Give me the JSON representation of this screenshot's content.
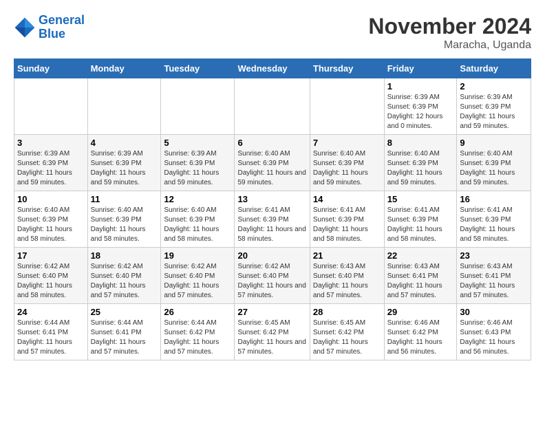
{
  "header": {
    "logo_general": "General",
    "logo_blue": "Blue",
    "month_title": "November 2024",
    "location": "Maracha, Uganda"
  },
  "days_of_week": [
    "Sunday",
    "Monday",
    "Tuesday",
    "Wednesday",
    "Thursday",
    "Friday",
    "Saturday"
  ],
  "weeks": [
    [
      {
        "day": "",
        "detail": ""
      },
      {
        "day": "",
        "detail": ""
      },
      {
        "day": "",
        "detail": ""
      },
      {
        "day": "",
        "detail": ""
      },
      {
        "day": "",
        "detail": ""
      },
      {
        "day": "1",
        "detail": "Sunrise: 6:39 AM\nSunset: 6:39 PM\nDaylight: 12 hours and 0 minutes."
      },
      {
        "day": "2",
        "detail": "Sunrise: 6:39 AM\nSunset: 6:39 PM\nDaylight: 11 hours and 59 minutes."
      }
    ],
    [
      {
        "day": "3",
        "detail": "Sunrise: 6:39 AM\nSunset: 6:39 PM\nDaylight: 11 hours and 59 minutes."
      },
      {
        "day": "4",
        "detail": "Sunrise: 6:39 AM\nSunset: 6:39 PM\nDaylight: 11 hours and 59 minutes."
      },
      {
        "day": "5",
        "detail": "Sunrise: 6:39 AM\nSunset: 6:39 PM\nDaylight: 11 hours and 59 minutes."
      },
      {
        "day": "6",
        "detail": "Sunrise: 6:40 AM\nSunset: 6:39 PM\nDaylight: 11 hours and 59 minutes."
      },
      {
        "day": "7",
        "detail": "Sunrise: 6:40 AM\nSunset: 6:39 PM\nDaylight: 11 hours and 59 minutes."
      },
      {
        "day": "8",
        "detail": "Sunrise: 6:40 AM\nSunset: 6:39 PM\nDaylight: 11 hours and 59 minutes."
      },
      {
        "day": "9",
        "detail": "Sunrise: 6:40 AM\nSunset: 6:39 PM\nDaylight: 11 hours and 59 minutes."
      }
    ],
    [
      {
        "day": "10",
        "detail": "Sunrise: 6:40 AM\nSunset: 6:39 PM\nDaylight: 11 hours and 58 minutes."
      },
      {
        "day": "11",
        "detail": "Sunrise: 6:40 AM\nSunset: 6:39 PM\nDaylight: 11 hours and 58 minutes."
      },
      {
        "day": "12",
        "detail": "Sunrise: 6:40 AM\nSunset: 6:39 PM\nDaylight: 11 hours and 58 minutes."
      },
      {
        "day": "13",
        "detail": "Sunrise: 6:41 AM\nSunset: 6:39 PM\nDaylight: 11 hours and 58 minutes."
      },
      {
        "day": "14",
        "detail": "Sunrise: 6:41 AM\nSunset: 6:39 PM\nDaylight: 11 hours and 58 minutes."
      },
      {
        "day": "15",
        "detail": "Sunrise: 6:41 AM\nSunset: 6:39 PM\nDaylight: 11 hours and 58 minutes."
      },
      {
        "day": "16",
        "detail": "Sunrise: 6:41 AM\nSunset: 6:39 PM\nDaylight: 11 hours and 58 minutes."
      }
    ],
    [
      {
        "day": "17",
        "detail": "Sunrise: 6:42 AM\nSunset: 6:40 PM\nDaylight: 11 hours and 58 minutes."
      },
      {
        "day": "18",
        "detail": "Sunrise: 6:42 AM\nSunset: 6:40 PM\nDaylight: 11 hours and 57 minutes."
      },
      {
        "day": "19",
        "detail": "Sunrise: 6:42 AM\nSunset: 6:40 PM\nDaylight: 11 hours and 57 minutes."
      },
      {
        "day": "20",
        "detail": "Sunrise: 6:42 AM\nSunset: 6:40 PM\nDaylight: 11 hours and 57 minutes."
      },
      {
        "day": "21",
        "detail": "Sunrise: 6:43 AM\nSunset: 6:40 PM\nDaylight: 11 hours and 57 minutes."
      },
      {
        "day": "22",
        "detail": "Sunrise: 6:43 AM\nSunset: 6:41 PM\nDaylight: 11 hours and 57 minutes."
      },
      {
        "day": "23",
        "detail": "Sunrise: 6:43 AM\nSunset: 6:41 PM\nDaylight: 11 hours and 57 minutes."
      }
    ],
    [
      {
        "day": "24",
        "detail": "Sunrise: 6:44 AM\nSunset: 6:41 PM\nDaylight: 11 hours and 57 minutes."
      },
      {
        "day": "25",
        "detail": "Sunrise: 6:44 AM\nSunset: 6:41 PM\nDaylight: 11 hours and 57 minutes."
      },
      {
        "day": "26",
        "detail": "Sunrise: 6:44 AM\nSunset: 6:42 PM\nDaylight: 11 hours and 57 minutes."
      },
      {
        "day": "27",
        "detail": "Sunrise: 6:45 AM\nSunset: 6:42 PM\nDaylight: 11 hours and 57 minutes."
      },
      {
        "day": "28",
        "detail": "Sunrise: 6:45 AM\nSunset: 6:42 PM\nDaylight: 11 hours and 57 minutes."
      },
      {
        "day": "29",
        "detail": "Sunrise: 6:46 AM\nSunset: 6:42 PM\nDaylight: 11 hours and 56 minutes."
      },
      {
        "day": "30",
        "detail": "Sunrise: 6:46 AM\nSunset: 6:43 PM\nDaylight: 11 hours and 56 minutes."
      }
    ]
  ]
}
